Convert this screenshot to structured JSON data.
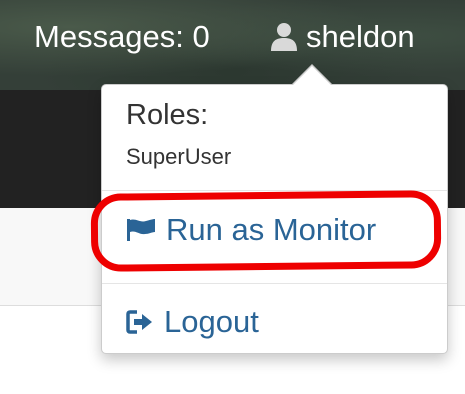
{
  "navbar": {
    "messages_label": "Messages: 0",
    "username": "sheldon",
    "user_icon": "user-icon"
  },
  "dropdown": {
    "roles_header": "Roles:",
    "roles_value": "SuperUser",
    "run_as_monitor": {
      "label": "Run as Monitor",
      "icon": "flag-icon"
    },
    "logout": {
      "label": "Logout",
      "icon": "sign-out-icon"
    }
  },
  "colors": {
    "link": "#2a6496",
    "highlight": "#ee0000",
    "navbar": "#343f38"
  }
}
